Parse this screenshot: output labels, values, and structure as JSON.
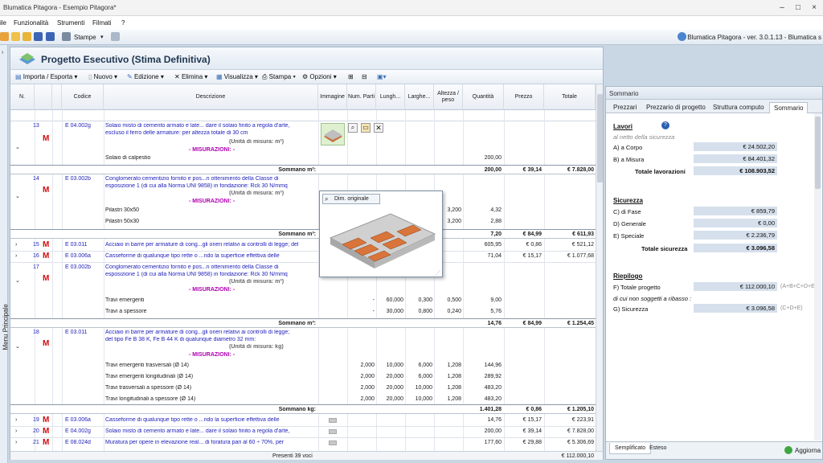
{
  "window": {
    "title": "Blumatica Pitagora - Esempio Pitagora*",
    "version": "Blumatica Pitagora - ver. 3.0.1.13 - Blumatica s"
  },
  "menu": [
    "ile",
    "Funzionalità",
    "Strumenti",
    "Filmati",
    "?"
  ],
  "toolbar": {
    "stampe": "Stampe"
  },
  "sidebar": {
    "label": "Menu Principale"
  },
  "page": {
    "title": "Progetto Esecutivo (Stima Definitiva)"
  },
  "actions": [
    "Importa / Esporta",
    "Nuovo",
    "Edizione",
    "Elimina",
    "Visualizza",
    "Stampa",
    "Opzioni"
  ],
  "columns": [
    "N.",
    "Codice",
    "Descrizione",
    "Immagine",
    "Num. Parti",
    "Lungh...",
    "Larghe...",
    "Altezza / peso",
    "Quantità",
    "Prezzo",
    "Totale"
  ],
  "rows": [
    {
      "n": "13",
      "code": "E 04.002g",
      "desc": [
        "Solaio misto di cemento armato e late... dare il solaio finito a regola d'arte,",
        "escluso il ferro delle armature: per altezza totale di 30 cm"
      ],
      "unit": "(Unità di misura: m²)",
      "mis": "- MISURAZIONI: -",
      "sub": [
        {
          "d": "Solaio di calpestio",
          "q": "200,00"
        }
      ],
      "sum": {
        "label": "Sommano m²:",
        "q": "200,00",
        "p": "€ 39,14",
        "t": "€ 7.828,00"
      }
    },
    {
      "n": "14",
      "code": "E 03.002b",
      "desc": [
        "Conglomerato cementizio fornito e pos...n ottenimento della Classe di",
        "esposizione 1 (di cui alla Norma UNI 9858) in fondazione: Rck 30 N/mmq"
      ],
      "unit": "(Unità di misura: m³)",
      "mis": "- MISURAZIONI: -",
      "sub": [
        {
          "d": "Pilastri 30x50",
          "h": "3,200",
          "q": "4,32"
        },
        {
          "d": "Pilastri 50x30",
          "h": "3,200",
          "q": "2,88"
        }
      ],
      "sum": {
        "label": "Sommano m³:",
        "q": "7,20",
        "p": "€ 84,99",
        "t": "€ 611,93"
      }
    },
    {
      "n": "15",
      "code": "E 03.011",
      "desc": [
        "Acciaio in barre per armature di cong...gli oneri relativi ai controlli di legge; del"
      ],
      "q": "605,95",
      "p": "€ 0,86",
      "t": "€ 521,12"
    },
    {
      "n": "16",
      "code": "E 03.006a",
      "desc": [
        "Casseforme di qualunque tipo rette o ...ndo la superficie effettiva delle"
      ],
      "q": "71,04",
      "p": "€ 15,17",
      "t": "€ 1.077,68"
    },
    {
      "n": "17",
      "code": "E 03.002b",
      "desc": [
        "Conglomerato cementizio fornito e pos...n ottenimento della Classe di",
        "esposizione 1 (di cui alla Norma UNI 9858) in fondazione: Rck 30 N/mmq"
      ],
      "unit": "(Unità di misura: m³)",
      "mis": "- MISURAZIONI: -",
      "sub": [
        {
          "d": "Travi emergenti",
          "np": "-",
          "l": "60,000",
          "w": "0,300",
          "h": "0,500",
          "q": "9,00"
        },
        {
          "d": "Travi a spessore",
          "np": "-",
          "l": "30,000",
          "w": "0,800",
          "h": "0,240",
          "q": "5,76"
        }
      ],
      "sum": {
        "label": "Sommano m³:",
        "q": "14,76",
        "p": "€ 84,99",
        "t": "€ 1.254,45"
      }
    },
    {
      "n": "18",
      "code": "E 03.011",
      "desc": [
        "Acciaio in barre per armature di cong...gli oneri relativi ai controlli di legge;",
        "del tipo Fe B 38 K, Fe B 44 K di qualunque diametro 32 mm:"
      ],
      "unit": "(Unità di misura: kg)",
      "mis": "- MISURAZIONI: -",
      "sub": [
        {
          "d": "Travi emergenti trasversali (Ø 14)",
          "np": "2,000",
          "l": "10,000",
          "w": "6,000",
          "h": "1,208",
          "q": "144,96"
        },
        {
          "d": "Travi emergenti longitudinali (Ø 14)",
          "np": "2,000",
          "l": "20,000",
          "w": "6,000",
          "h": "1,208",
          "q": "289,92"
        },
        {
          "d": "Travi trasversali a spessore (Ø 14)",
          "np": "2,000",
          "l": "20,000",
          "w": "10,000",
          "h": "1,208",
          "q": "483,20"
        },
        {
          "d": "Travi longitudinali a spessore (Ø 14)",
          "np": "2,000",
          "l": "20,000",
          "w": "10,000",
          "h": "1,208",
          "q": "483,20"
        }
      ],
      "sum": {
        "label": "Sommano kg:",
        "q": "1.401,28",
        "p": "€ 0,86",
        "t": "€ 1.205,10"
      }
    },
    {
      "n": "19",
      "code": "E 03.006a",
      "desc": [
        "Casseforme di qualunque tipo rette o ...ndo la superficie effettiva delle"
      ],
      "q": "14,76",
      "p": "€ 15,17",
      "t": "€ 223,91"
    },
    {
      "n": "20",
      "code": "E 04.002g",
      "desc": [
        "Solaio misto di cemento armato e late... dare il solaio finito a regola d'arte,"
      ],
      "q": "200,00",
      "p": "€ 39,14",
      "t": "€ 7.828,00"
    },
    {
      "n": "21",
      "code": "E 08.024d",
      "desc": [
        "Muratura per opere in elevazione real... di foratura pari al 60 ÷ 70%, per"
      ],
      "q": "177,60",
      "p": "€ 29,88",
      "t": "€ 5.306,69"
    }
  ],
  "marker": "M",
  "popup": {
    "button": "Dim. originale"
  },
  "footer": {
    "count": "Presenti 39 voci",
    "total": "€ 112.000,10"
  },
  "summary": {
    "panel_title": "Sommario",
    "tabs": [
      "Prezzari",
      "Prezzario di progetto",
      "Struttura computo",
      "Sommario"
    ],
    "lavori": {
      "title": "Lavori",
      "note": "al netto della sicurezza",
      "items": [
        {
          "label": "A) a Corpo",
          "value": "€ 24.502,20"
        },
        {
          "label": "B) a Misura",
          "value": "€ 84.401,32"
        }
      ],
      "total_label": "Totale lavorazioni",
      "total": "€ 108.903,52"
    },
    "sicurezza": {
      "title": "Sicurezza",
      "items": [
        {
          "label": "C) di Fase",
          "value": "€ 859,79"
        },
        {
          "label": "D) Generale",
          "value": "€ 0,00"
        },
        {
          "label": "E) Speciale",
          "value": "€ 2.236,79"
        }
      ],
      "total_label": "Totale sicurezza",
      "total": "€ 3.096,58"
    },
    "riepilogo": {
      "title": "Riepilogo",
      "f_label": "F) Totale progetto",
      "f_value": "€ 112.000,10",
      "f_formula": "(A+B+C+D+E)",
      "note": "di cui non soggetti a ribasso :",
      "g_label": "G) Sicurezza",
      "g_value": "€ 3.096,58",
      "g_formula": "(C+D+E)"
    },
    "bottom_tabs": [
      "Semplificato",
      "Esteso"
    ],
    "update": "Aggiorna"
  }
}
